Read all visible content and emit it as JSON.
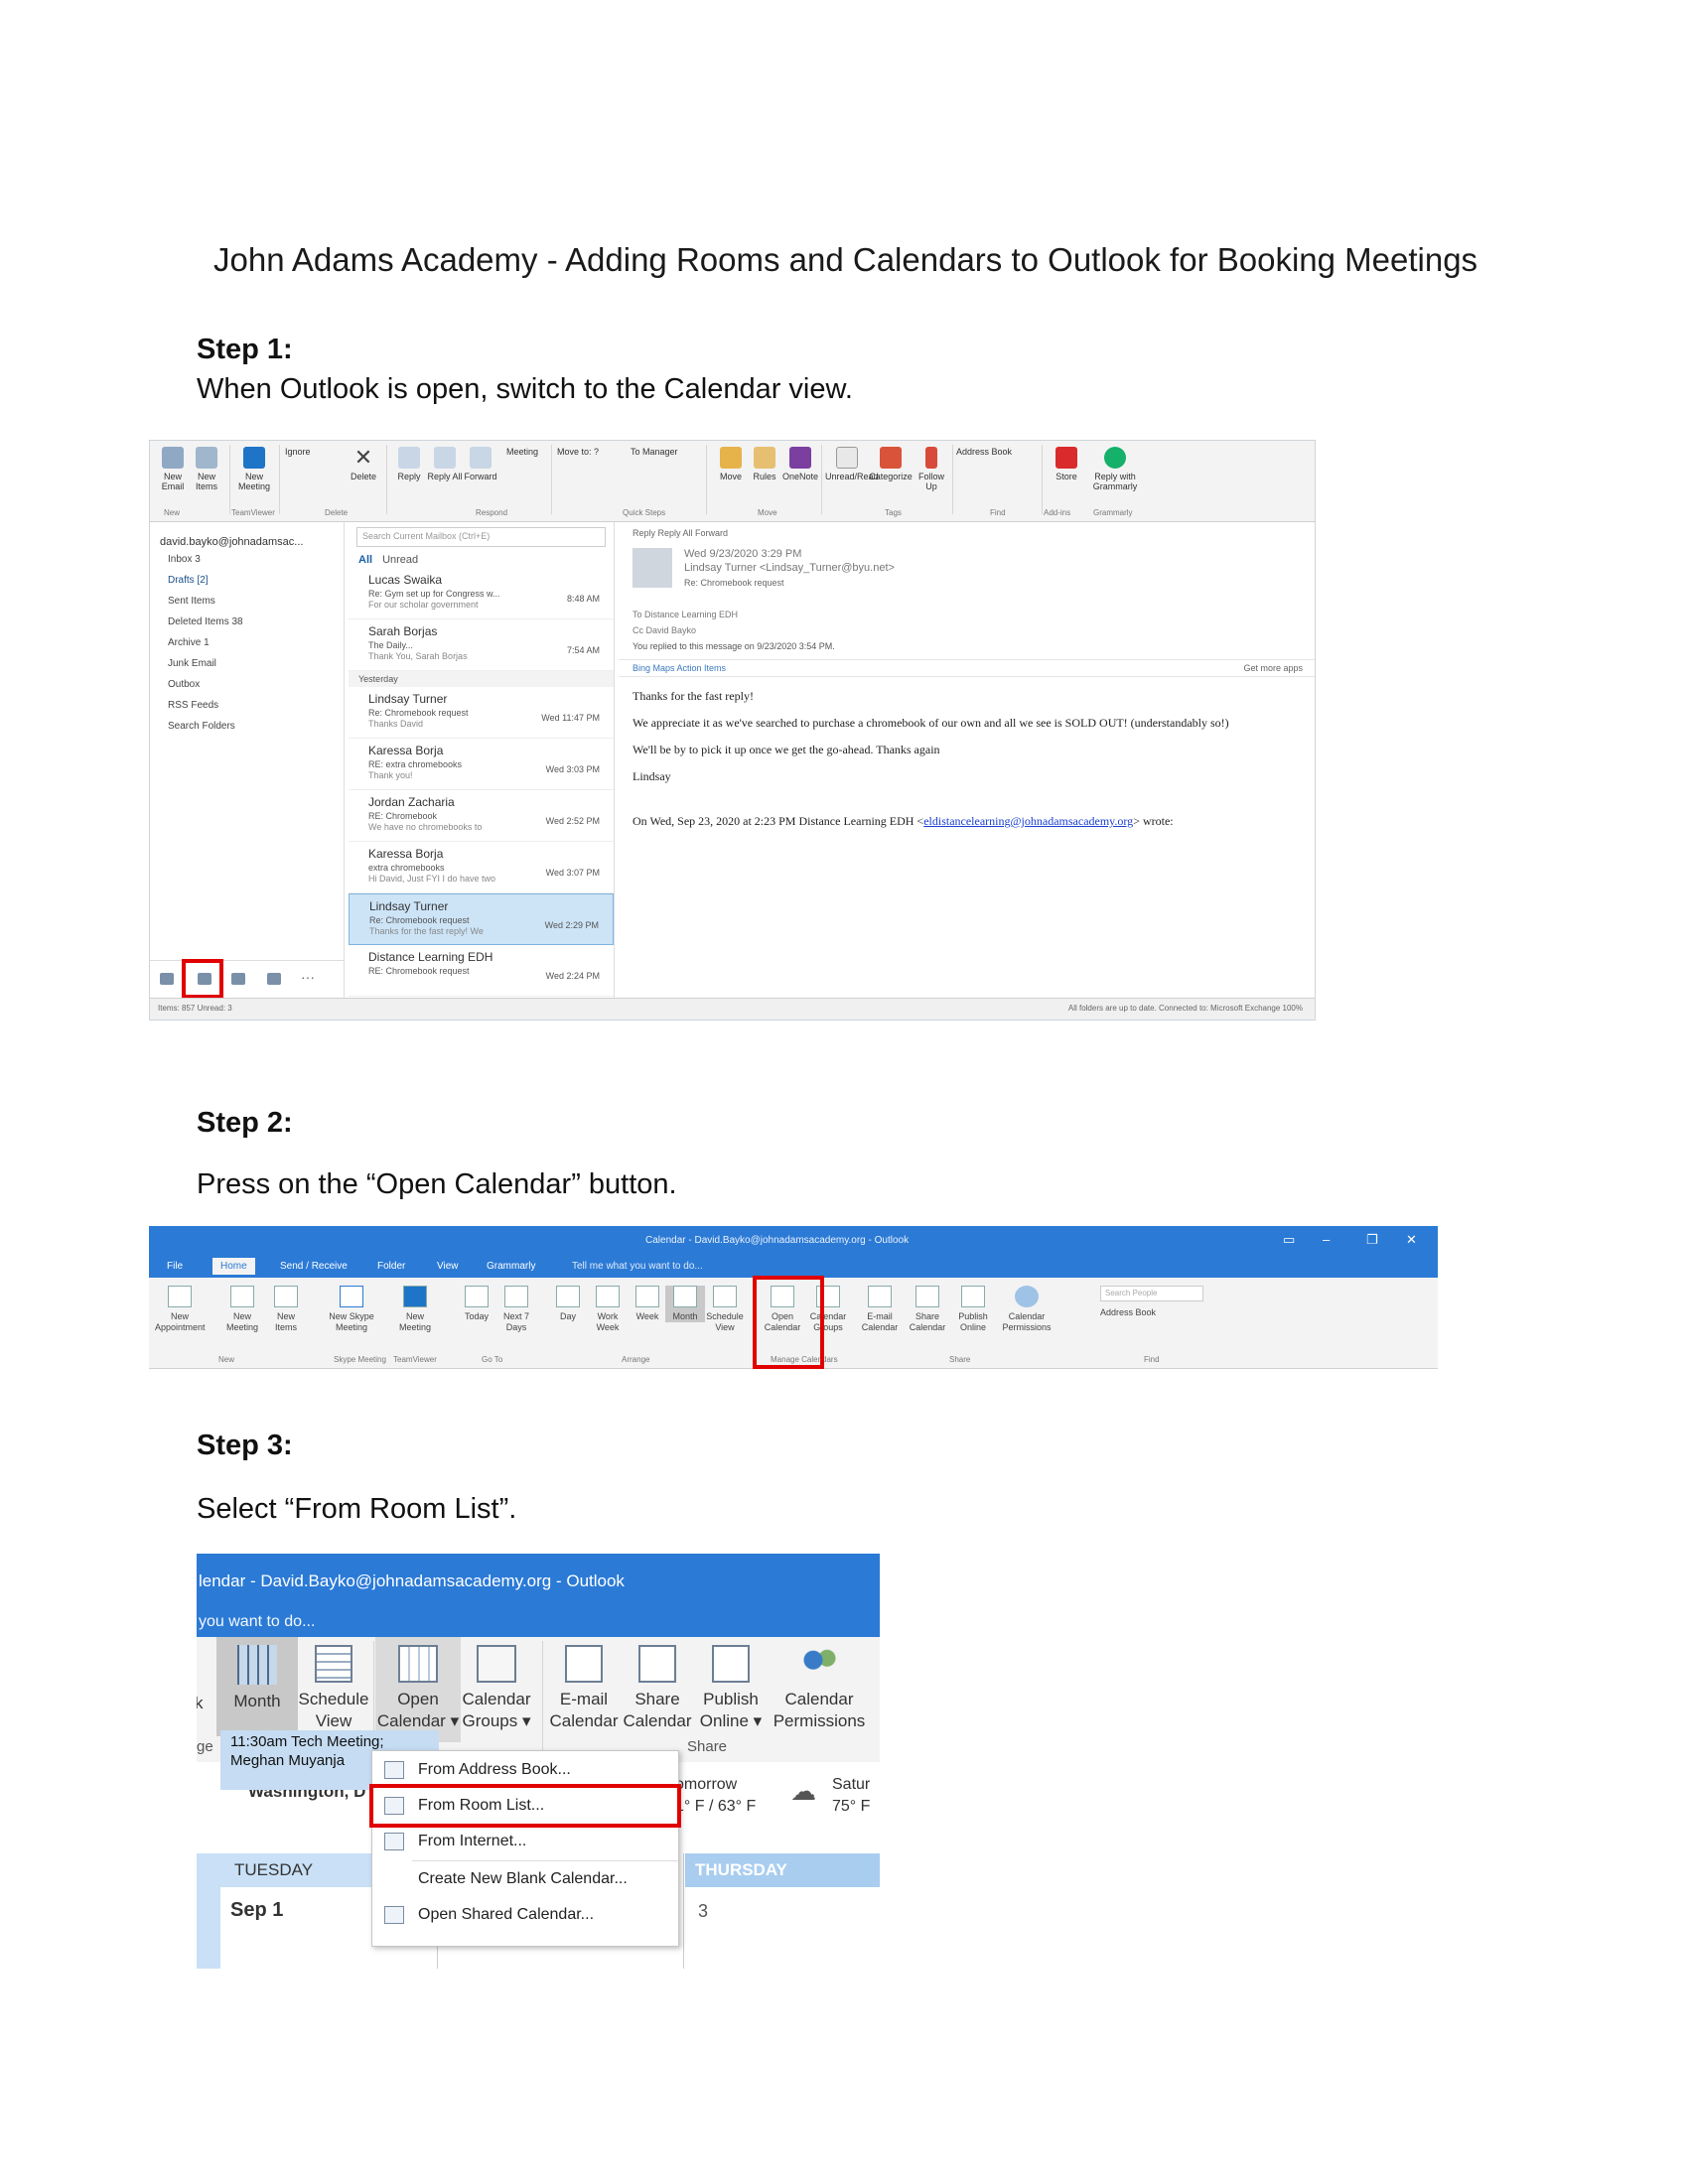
{
  "document": {
    "title": "John Adams Academy - Adding Rooms and Calendars to Outlook for Booking Meetings"
  },
  "steps": [
    {
      "heading": "Step 1:",
      "text": "When Outlook is open, switch to the Calendar view."
    },
    {
      "heading": "Step 2:",
      "text": "Press on the “Open Calendar” button."
    },
    {
      "heading": "Step 3:",
      "text": "Select “From Room List”."
    }
  ],
  "shot1": {
    "account": "david.bayko@johnadamsac...",
    "folders": [
      "Inbox 3",
      "Drafts [2]",
      "Sent Items",
      "Deleted Items 38",
      "Archive 1",
      "Junk Email",
      "Outbox",
      "RSS Feeds",
      "Search Folders"
    ],
    "search_placeholder": "Search Current Mailbox (Ctrl+E)",
    "tabs_all": "All",
    "tabs_unread": "Unread",
    "group_yesterday": "Yesterday",
    "messages": [
      {
        "from": "Lucas Swaika",
        "subject": "Re: Gym set up for Congress w...",
        "preview": "For our scholar government",
        "time": "8:48 AM"
      },
      {
        "from": "Sarah Borjas",
        "subject": "The Daily...",
        "preview": "Thank You, Sarah Borjas",
        "time": "7:54 AM"
      },
      {
        "from": "Lindsay Turner",
        "subject": "Re: Chromebook request",
        "preview": "Thanks David",
        "time": "Wed 11:47 PM"
      },
      {
        "from": "Karessa Borja",
        "subject": "RE: extra chromebooks",
        "preview": "Thank you!",
        "time": "Wed 3:03 PM"
      },
      {
        "from": "Jordan Zacharia",
        "subject": "RE: Chromebook",
        "preview": "We have no chromebooks to",
        "time": "Wed 2:52 PM"
      },
      {
        "from": "Karessa Borja",
        "subject": "extra chromebooks",
        "preview": "Hi David, Just FYI I do have two",
        "time": "Wed 3:07 PM"
      },
      {
        "from": "Lindsay Turner",
        "subject": "Re: Chromebook request",
        "preview": "Thanks for the fast reply! We",
        "time": "Wed 2:29 PM"
      },
      {
        "from": "Distance Learning EDH",
        "subject": "RE: Chromebook request",
        "preview": "",
        "time": "Wed 2:24 PM"
      }
    ],
    "reading": {
      "actions": "Reply   Reply All   Forward",
      "date": "Wed 9/23/2020 3:29 PM",
      "from": "Lindsay Turner <Lindsay_Turner@byu.net>",
      "subject": "Re: Chromebook request",
      "to": "To  Distance Learning EDH",
      "cc": "Cc  David Bayko",
      "info": "You replied to this message on 9/23/2020 3:54 PM.",
      "links": "Bing Maps      Action Items",
      "get_apps": "Get more apps",
      "body": [
        "Thanks for the fast reply!",
        "We appreciate it as we've searched to purchase a chromebook of our own and all we see is SOLD OUT! (understandably so!)",
        "We'll be by to pick it up once we get the go-ahead. Thanks again",
        "Lindsay"
      ],
      "quote_prefix": "On Wed, Sep 23, 2020 at 2:23 PM Distance Learning EDH <",
      "quote_link": "eldistancelearning@johnadamsacademy.org",
      "quote_suffix": "> wrote:"
    },
    "status_left": "Items: 857    Unread: 3",
    "status_right": "All folders are up to date.    Connected to: Microsoft Exchange    100%",
    "ribbon": [
      "New Email",
      "New Items",
      "New Meeting",
      "Ignore",
      "Delete",
      "Reply",
      "Reply All",
      "Forward",
      "Meeting",
      "Move to: ?",
      "To Manager",
      "Move",
      "Rules",
      "OneNote",
      "Unread/Read",
      "Categorize",
      "Follow Up",
      "Address Book",
      "Store",
      "Reply with Grammarly"
    ],
    "ribbon_groups": [
      "New",
      "TeamViewer",
      "Delete",
      "Respond",
      "Quick Steps",
      "Move",
      "Tags",
      "Find",
      "Add-ins",
      "Grammarly"
    ]
  },
  "shot2": {
    "title": "Calendar - David.Bayko@johnadamsacademy.org - Outlook",
    "tabs": [
      "File",
      "Home",
      "Send / Receive",
      "Folder",
      "View",
      "Grammarly",
      "Tell me what you want to do..."
    ],
    "buttons": [
      "New Appointment",
      "New Meeting",
      "New Items",
      "New Skype Meeting",
      "New Meeting",
      "Today",
      "Next 7 Days",
      "Day",
      "Work Week",
      "Week",
      "Month",
      "Schedule View",
      "Open Calendar",
      "Calendar Groups",
      "E-mail Calendar",
      "Share Calendar",
      "Publish Online",
      "Calendar Permissions"
    ],
    "groups": [
      "New",
      "Skype Meeting",
      "TeamViewer",
      "Go To",
      "Arrange",
      "Manage Calendars",
      "Share",
      "Find"
    ],
    "search": "Search People",
    "address_book": "Address Book"
  },
  "shot3": {
    "title": "lendar - David.Bayko@johnadamsacademy.org - Outlook",
    "tellme": "you want to do...",
    "buttons": {
      "k": "k",
      "month": "Month",
      "schedule_1": "Schedule",
      "schedule_2": "View",
      "open_1": "Open",
      "open_2": "Calendar",
      "groups_1": "Calendar",
      "groups_2": "Groups",
      "email_1": "E-mail",
      "email_2": "Calendar",
      "share_1": "Share",
      "share_2": "Calendar",
      "publish_1": "Publish",
      "publish_2": "Online",
      "perm_1": "Calendar",
      "perm_2": "Permissions"
    },
    "group_ge": "ge",
    "group_share": "Share",
    "location": "Washington, D",
    "weather_tomorrow_1": "omorrow",
    "weather_tomorrow_2": "1° F / 63° F",
    "weather_sat_1": "Satur",
    "weather_sat_2": "75° F",
    "day_tuesday": "TUESDAY",
    "day_thursday": "THURSDAY",
    "date_tue": "Sep 1",
    "date_thu": "3",
    "event_1": "11:30am Tech Meeting;",
    "event_2": "Meghan Muyanja",
    "menu": [
      "From Address Book...",
      "From Room List...",
      "From Internet...",
      "Create New Blank Calendar...",
      "Open Shared Calendar..."
    ]
  },
  "colors": {
    "accent": "#2b7ad6",
    "highlight": "#e00000",
    "event_fill": "#c5dcf2",
    "day_header": "#a9cdef"
  }
}
